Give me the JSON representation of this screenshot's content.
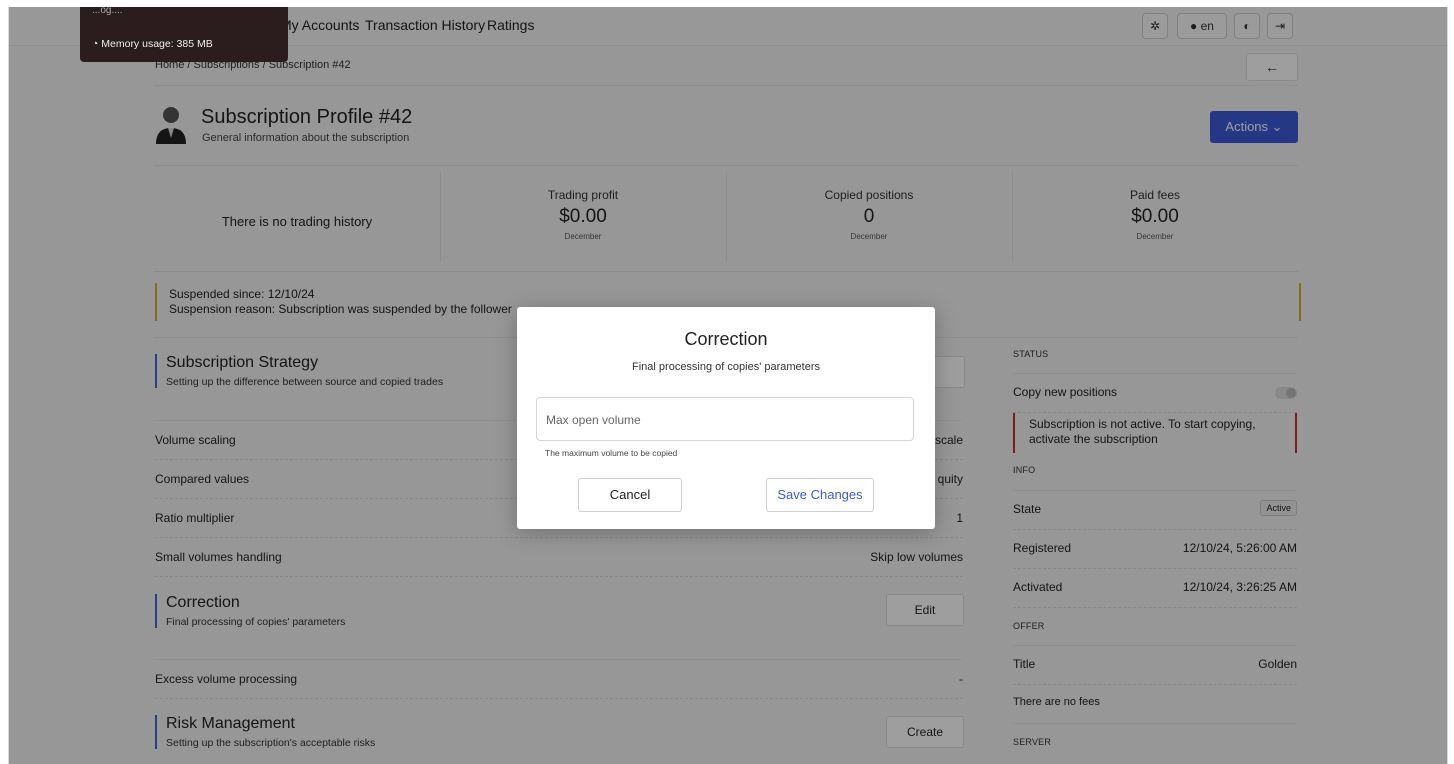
{
  "tooltip": {
    "top_text": "...og....",
    "memory": "Memory usage: 385 MB"
  },
  "nav": {
    "links": [
      "My Accounts",
      "Transaction History",
      "Ratings"
    ],
    "lang": "en"
  },
  "breadcrumb": "Home / Subscriptions / Subscription #42",
  "back_arrow": "←",
  "header": {
    "title": "Subscription Profile #42",
    "subtitle": "General information about the subscription",
    "actions": "Actions"
  },
  "stats": {
    "no_history": "There is no trading history",
    "cells": [
      {
        "label": "Trading profit",
        "value": "$0.00",
        "period": "December"
      },
      {
        "label": "Copied positions",
        "value": "0",
        "period": "December"
      },
      {
        "label": "Paid fees",
        "value": "$0.00",
        "period": "December"
      }
    ]
  },
  "suspension": {
    "since": "Suspended since: 12/10/24",
    "reason": "Suspension reason: Subscription was suspended by the follower"
  },
  "strategy": {
    "title": "Subscription Strategy",
    "subtitle": "Setting up the difference between source and copied trades",
    "rows": [
      {
        "key": "Volume scaling",
        "value": "scale"
      },
      {
        "key": "Compared values",
        "value": "quity"
      },
      {
        "key": "Ratio multiplier",
        "value": "1"
      },
      {
        "key": "Small volumes handling",
        "value": "Skip low volumes"
      }
    ]
  },
  "correction": {
    "title": "Correction",
    "subtitle": "Final processing of copies' parameters",
    "edit": "Edit",
    "rows": [
      {
        "key": "Excess volume processing",
        "value": "-"
      }
    ]
  },
  "risk": {
    "title": "Risk Management",
    "subtitle": "Setting up the subscription's acceptable risks",
    "create": "Create"
  },
  "right": {
    "status_head": "STATUS",
    "copy_new": "Copy new positions",
    "alert": "Subscription is not active. To start copying, activate the subscription",
    "info_head": "INFO",
    "state_key": "State",
    "state_val": "Active",
    "registered_key": "Registered",
    "registered_val": "12/10/24, 5:26:00 AM",
    "activated_key": "Activated",
    "activated_val": "12/10/24, 3:26:25 AM",
    "offer_head": "OFFER",
    "title_key": "Title",
    "title_val": "Golden",
    "no_fees": "There are no fees",
    "server_head": "SERVER"
  },
  "modal": {
    "title": "Correction",
    "subtitle": "Final processing of copies' parameters",
    "placeholder": "Max open volume",
    "help": "The maximum volume to be copied",
    "cancel": "Cancel",
    "save": "Save Changes"
  }
}
